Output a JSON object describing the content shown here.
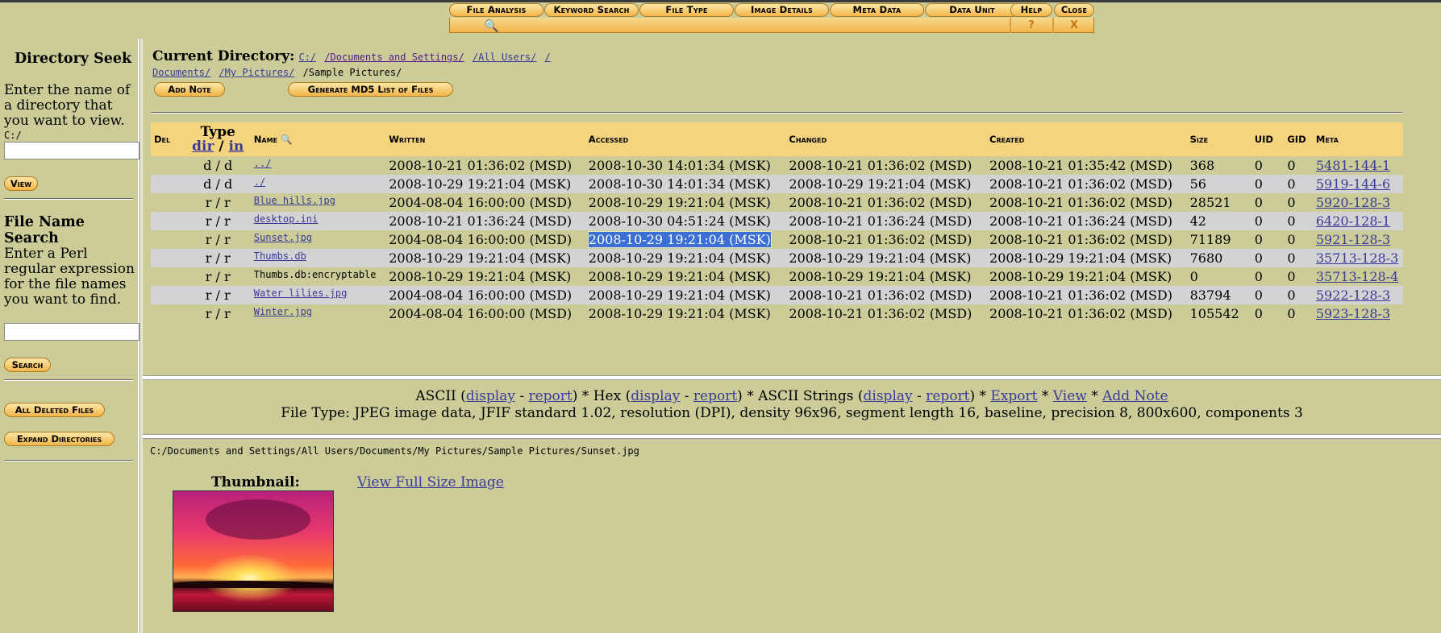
{
  "tabs": {
    "file_analysis": "File Analysis",
    "keyword_search": "Keyword Search",
    "file_type": "File Type",
    "image_details": "Image Details",
    "meta_data": "Meta Data",
    "data_unit": "Data Unit",
    "help": "Help",
    "help_icon": "?",
    "close": "Close",
    "close_icon": "X"
  },
  "sidebar": {
    "dir_title": "Directory Seek",
    "dir_text": "Enter the name of a directory that you want to view.",
    "dir_value": "C:/",
    "view_button": "View",
    "fname_title": "File Name Search",
    "fname_text": "Enter a Perl regular expression for the file names you want to find.",
    "search_button": "Search",
    "deleted_button": "All Deleted Files",
    "expand_button": "Expand Directories"
  },
  "current_dir": {
    "label": "Current Directory:",
    "crumbs": [
      "C:/",
      "/Documents and Settings/",
      "/All Users/",
      "/",
      "Documents/",
      "/My Pictures/"
    ],
    "current": "/Sample Pictures/"
  },
  "buttons": {
    "add_note": "Add Note",
    "md5": "Generate MD5 List of Files"
  },
  "table": {
    "headers": {
      "del": "Del",
      "type": "Type",
      "type_dir": "dir",
      "type_sep": "/",
      "type_in": "in",
      "name": "Name",
      "written": "Written",
      "accessed": "Accessed",
      "changed": "Changed",
      "created": "Created",
      "size": "Size",
      "uid": "UID",
      "gid": "GID",
      "meta": "Meta"
    },
    "rows": [
      {
        "type": "d / d",
        "name": "../",
        "written": "2008-10-21 01:36:02 (MSD)",
        "accessed": "2008-10-30 14:01:34 (MSK)",
        "changed": "2008-10-21 01:36:02 (MSD)",
        "created": "2008-10-21 01:35:42 (MSD)",
        "size": "368",
        "uid": "0",
        "gid": "0",
        "meta": "5481-144-1"
      },
      {
        "type": "d / d",
        "name": "./",
        "written": "2008-10-29 19:21:04 (MSK)",
        "accessed": "2008-10-30 14:01:34 (MSK)",
        "changed": "2008-10-29 19:21:04 (MSK)",
        "created": "2008-10-21 01:36:02 (MSD)",
        "size": "56",
        "uid": "0",
        "gid": "0",
        "meta": "5919-144-6"
      },
      {
        "type": "r / r",
        "name": "Blue hills.jpg",
        "written": "2004-08-04 16:00:00 (MSD)",
        "accessed": "2008-10-29 19:21:04 (MSK)",
        "changed": "2008-10-21 01:36:02 (MSD)",
        "created": "2008-10-21 01:36:02 (MSD)",
        "size": "28521",
        "uid": "0",
        "gid": "0",
        "meta": "5920-128-3"
      },
      {
        "type": "r / r",
        "name": "desktop.ini",
        "written": "2008-10-21 01:36:24 (MSD)",
        "accessed": "2008-10-30 04:51:24 (MSK)",
        "changed": "2008-10-21 01:36:24 (MSD)",
        "created": "2008-10-21 01:36:24 (MSD)",
        "size": "42",
        "uid": "0",
        "gid": "0",
        "meta": "6420-128-1"
      },
      {
        "type": "r / r",
        "name": "Sunset.jpg",
        "written": "2004-08-04 16:00:00 (MSD)",
        "accessed": "2008-10-29 19:21:04 (MSK)",
        "changed": "2008-10-21 01:36:02 (MSD)",
        "created": "2008-10-21 01:36:02 (MSD)",
        "size": "71189",
        "uid": "0",
        "gid": "0",
        "meta": "5921-128-3"
      },
      {
        "type": "r / r",
        "name": "Thumbs.db",
        "written": "2008-10-29 19:21:04 (MSK)",
        "accessed": "2008-10-29 19:21:04 (MSK)",
        "changed": "2008-10-29 19:21:04 (MSK)",
        "created": "2008-10-29 19:21:04 (MSK)",
        "size": "7680",
        "uid": "0",
        "gid": "0",
        "meta": "35713-128-3"
      },
      {
        "type": "r / r",
        "name": "Thumbs.db:encryptable",
        "written": "2008-10-29 19:21:04 (MSK)",
        "accessed": "2008-10-29 19:21:04 (MSK)",
        "changed": "2008-10-29 19:21:04 (MSK)",
        "created": "2008-10-29 19:21:04 (MSK)",
        "size": "0",
        "uid": "0",
        "gid": "0",
        "meta": "35713-128-4"
      },
      {
        "type": "r / r",
        "name": "Water lilies.jpg",
        "written": "2004-08-04 16:00:00 (MSD)",
        "accessed": "2008-10-29 19:21:04 (MSK)",
        "changed": "2008-10-21 01:36:02 (MSD)",
        "created": "2008-10-21 01:36:02 (MSD)",
        "size": "83794",
        "uid": "0",
        "gid": "0",
        "meta": "5922-128-3"
      },
      {
        "type": "r / r",
        "name": "Winter.jpg",
        "written": "2004-08-04 16:00:00 (MSD)",
        "accessed": "2008-10-29 19:21:04 (MSK)",
        "changed": "2008-10-21 01:36:02 (MSD)",
        "created": "2008-10-21 01:36:02 (MSD)",
        "size": "105542",
        "uid": "0",
        "gid": "0",
        "meta": "5923-128-3"
      }
    ]
  },
  "view_bar": {
    "ascii": "ASCII (",
    "display": "display",
    "dash": " - ",
    "report": "report",
    "close_star": ") * ",
    "hex": "Hex (",
    "ascii_strings": "ASCII Strings (",
    "export": "Export",
    "star": " * ",
    "view": "View",
    "add_note": "Add Note",
    "file_type": "File Type: JPEG image data, JFIF standard 1.02, resolution (DPI), density 96x96, segment length 16, baseline, precision 8, 800x600, components 3"
  },
  "file_view": {
    "path": "C:/Documents and Settings/All Users/Documents/My Pictures/Sample Pictures/Sunset.jpg",
    "thumb_label": "Thumbnail:",
    "full_link": "View Full Size Image"
  }
}
